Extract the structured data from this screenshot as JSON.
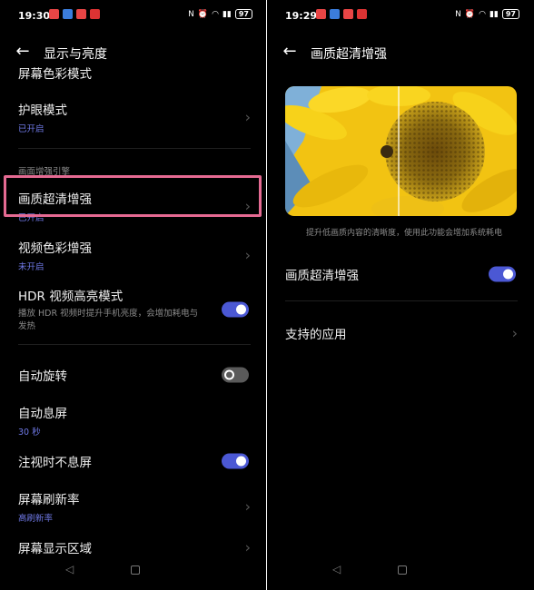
{
  "left": {
    "status": {
      "time": "19:30",
      "battery": "97"
    },
    "header": {
      "title": "显示与亮度"
    },
    "rows": [
      {
        "title": "屏幕色彩模式"
      },
      {
        "title": "护眼模式",
        "sub": "已开启"
      },
      {
        "section": "画面增强引擎"
      },
      {
        "title": "画质超清增强",
        "sub": "已开启"
      },
      {
        "title": "视频色彩增强",
        "sub": "未开启"
      },
      {
        "title": "HDR 视频高亮模式",
        "desc": "播放 HDR 视频时提升手机亮度，会增加耗电与发热",
        "toggle": "on"
      },
      {
        "title": "自动旋转",
        "toggle": "off"
      },
      {
        "title": "自动息屏",
        "sub": "30 秒"
      },
      {
        "title": "注视时不息屏",
        "toggle": "on"
      },
      {
        "title": "屏幕刷新率",
        "sub": "高刷新率"
      },
      {
        "title": "屏幕显示区域"
      }
    ]
  },
  "right": {
    "status": {
      "time": "19:29",
      "battery": "97"
    },
    "header": {
      "title": "画质超清增强"
    },
    "caption": "提升低画质内容的清晰度，使用此功能会增加系统耗电",
    "rows": [
      {
        "title": "画质超清增强",
        "toggle": "on"
      },
      {
        "title": "支持的应用"
      }
    ]
  },
  "colors": {
    "accent": "#4b58d4",
    "highlight": "#e56a92",
    "sub_text": "#6f79e6"
  },
  "icons": [
    "back-arrow-icon",
    "chevron-right-icon",
    "nav-back-icon",
    "nav-home-icon",
    "wifi-icon",
    "signal-icon",
    "alarm-icon",
    "nfc-icon"
  ]
}
